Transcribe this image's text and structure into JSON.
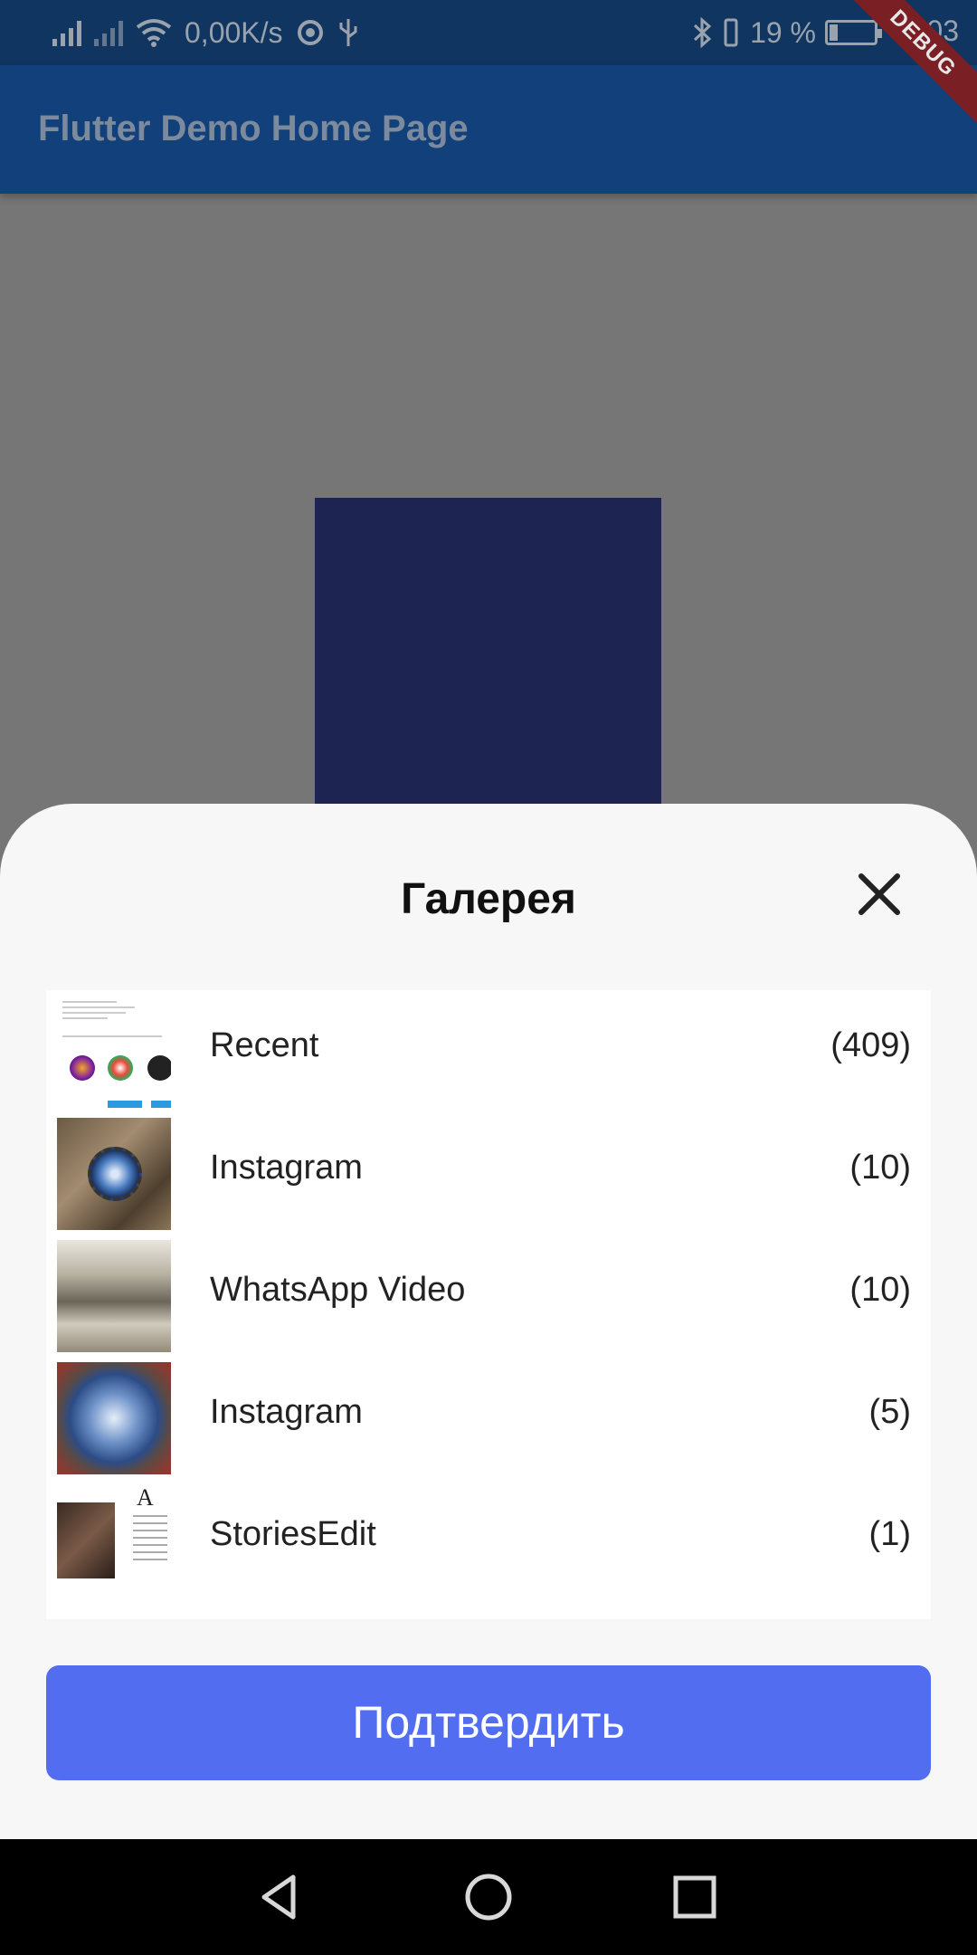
{
  "status_bar": {
    "speed": "0,00K/s",
    "battery": "19 %",
    "time": "8:03",
    "battery_level": 0.19
  },
  "debug_banner": "DEBUG",
  "app_bar": {
    "title": "Flutter Demo Home Page"
  },
  "sheet": {
    "title": "Галерея",
    "albums": [
      {
        "name": "Recent",
        "count": "(409)",
        "thumb": "recent-screenshot"
      },
      {
        "name": "Instagram",
        "count": "(10)",
        "thumb": "pendant-photo"
      },
      {
        "name": "WhatsApp Video",
        "count": "(10)",
        "thumb": "stone-photo"
      },
      {
        "name": "Instagram",
        "count": "(5)",
        "thumb": "galaxy-pendant-photo"
      },
      {
        "name": "StoriesEdit",
        "count": "(1)",
        "thumb": "document-photo"
      }
    ],
    "confirm_label": "Подтвердить"
  },
  "colors": {
    "status_bar": "#0f3560",
    "app_bar": "#11407a",
    "accent": "#536df0",
    "square": "#1d2452"
  }
}
